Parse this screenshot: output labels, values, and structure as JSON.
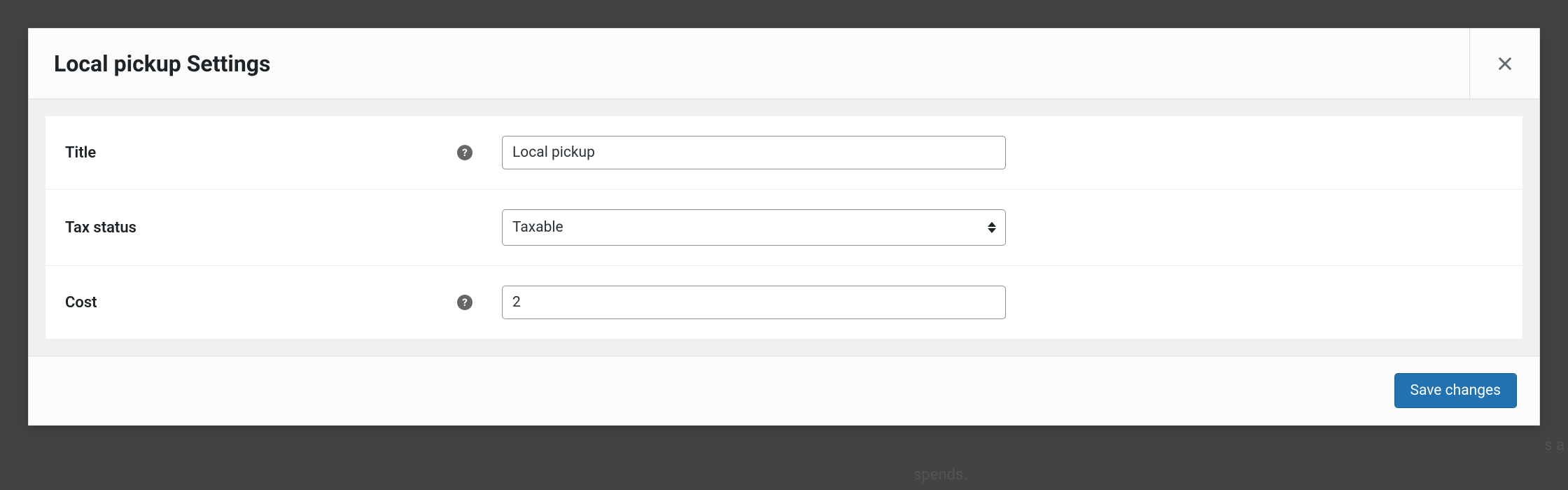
{
  "modal": {
    "title": "Local pickup Settings"
  },
  "form": {
    "title": {
      "label": "Title",
      "value": "Local pickup",
      "help": "?"
    },
    "tax_status": {
      "label": "Tax status",
      "value": "Taxable"
    },
    "cost": {
      "label": "Cost",
      "value": "2",
      "help": "?"
    }
  },
  "footer": {
    "save_label": "Save changes"
  },
  "background": {
    "spends": "spends.",
    "right": "s a"
  }
}
